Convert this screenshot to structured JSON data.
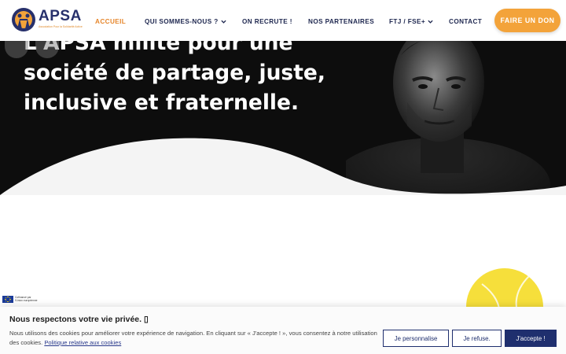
{
  "brand": {
    "name": "APSA",
    "tagline": "Association Pour la Solidarité Active",
    "colors": {
      "navy": "#1f2850",
      "orange": "#e6862b",
      "donate": "#f3a33a",
      "yellow": "#f6df3b"
    }
  },
  "nav": {
    "items": [
      {
        "label": "ACCUEIL",
        "active": true,
        "dropdown": false
      },
      {
        "label": "QUI SOMMES-NOUS ?",
        "active": false,
        "dropdown": true
      },
      {
        "label": "ON RECRUTE !",
        "active": false,
        "dropdown": false
      },
      {
        "label": "NOS PARTENAIRES",
        "active": false,
        "dropdown": false
      },
      {
        "label": "FTJ / FSE+",
        "active": false,
        "dropdown": true
      },
      {
        "label": "CONTACT",
        "active": false,
        "dropdown": false
      }
    ],
    "donate_label": "FAIRE UN DON"
  },
  "hero": {
    "lines": [
      "L'APSA milite pour une",
      "société de partage, juste,",
      "inclusive et fraternelle."
    ]
  },
  "eu_badge": {
    "line1": "Cofinancé par",
    "line2": "l'Union européenne"
  },
  "cookie": {
    "title": "Nous respectons votre vie privée. ▯",
    "text": "Nous utilisons des cookies pour améliorer votre expérience de navigation. En cliquant sur « J'accepte ! », vous consentez à notre utilisation des cookies.",
    "link": "Politique relative aux cookies",
    "buttons": {
      "customize": "Je personnalise",
      "refuse": "Je refuse.",
      "accept": "J'accepte !"
    }
  }
}
